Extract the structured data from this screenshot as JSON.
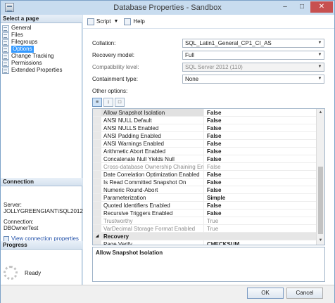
{
  "window": {
    "title": "Database Properties - Sandbox"
  },
  "left_pane": {
    "select_page_header": "Select a page",
    "pages": [
      {
        "label": "General",
        "selected": false
      },
      {
        "label": "Files",
        "selected": false
      },
      {
        "label": "Filegroups",
        "selected": false
      },
      {
        "label": "Options",
        "selected": true
      },
      {
        "label": "Change Tracking",
        "selected": false
      },
      {
        "label": "Permissions",
        "selected": false
      },
      {
        "label": "Extended Properties",
        "selected": false
      }
    ],
    "connection_header": "Connection",
    "server_label": "Server:",
    "server_value": "JOLLYGREENGIANT\\SQL2012",
    "connection_label": "Connection:",
    "connection_value": "DBOwnerTest",
    "view_connection_link": "View connection properties",
    "progress_header": "Progress",
    "progress_status": "Ready"
  },
  "toolbar": {
    "script_label": "Script",
    "help_label": "Help"
  },
  "form": {
    "collation": {
      "label": "Collation:",
      "value": "SQL_Latin1_General_CP1_CI_AS"
    },
    "recovery_model": {
      "label": "Recovery model:",
      "value": "Full"
    },
    "compat_level": {
      "label": "Compatibility level:",
      "value": "SQL Server 2012 (110)"
    },
    "containment": {
      "label": "Containment type:",
      "value": "None"
    },
    "other_options_label": "Other options:"
  },
  "grid": {
    "rows": [
      {
        "name": "Allow Snapshot Isolation",
        "value": "False",
        "state": "selected"
      },
      {
        "name": "ANSI NULL Default",
        "value": "False",
        "state": "normal"
      },
      {
        "name": "ANSI NULLS Enabled",
        "value": "False",
        "state": "normal"
      },
      {
        "name": "ANSI Padding Enabled",
        "value": "False",
        "state": "normal"
      },
      {
        "name": "ANSI Warnings Enabled",
        "value": "False",
        "state": "normal"
      },
      {
        "name": "Arithmetic Abort Enabled",
        "value": "False",
        "state": "normal"
      },
      {
        "name": "Concatenate Null Yields Null",
        "value": "False",
        "state": "normal"
      },
      {
        "name": "Cross-database Ownership Chaining Enabled",
        "value": "False",
        "state": "disabled"
      },
      {
        "name": "Date Correlation Optimization Enabled",
        "value": "False",
        "state": "normal"
      },
      {
        "name": "Is Read Committed Snapshot On",
        "value": "False",
        "state": "normal"
      },
      {
        "name": "Numeric Round-Abort",
        "value": "False",
        "state": "normal"
      },
      {
        "name": "Parameterization",
        "value": "Simple",
        "state": "normal"
      },
      {
        "name": "Quoted Identifiers Enabled",
        "value": "False",
        "state": "normal"
      },
      {
        "name": "Recursive Triggers Enabled",
        "value": "False",
        "state": "normal"
      },
      {
        "name": "Trustworthy",
        "value": "True",
        "state": "disabled"
      },
      {
        "name": "VarDecimal Storage Format Enabled",
        "value": "True",
        "state": "disabled"
      },
      {
        "name": "Recovery",
        "value": "",
        "state": "category"
      },
      {
        "name": "Page Verify",
        "value": "CHECKSUM",
        "state": "normal"
      }
    ],
    "description": "Allow Snapshot Isolation"
  },
  "buttons": {
    "ok": "OK",
    "cancel": "Cancel"
  }
}
